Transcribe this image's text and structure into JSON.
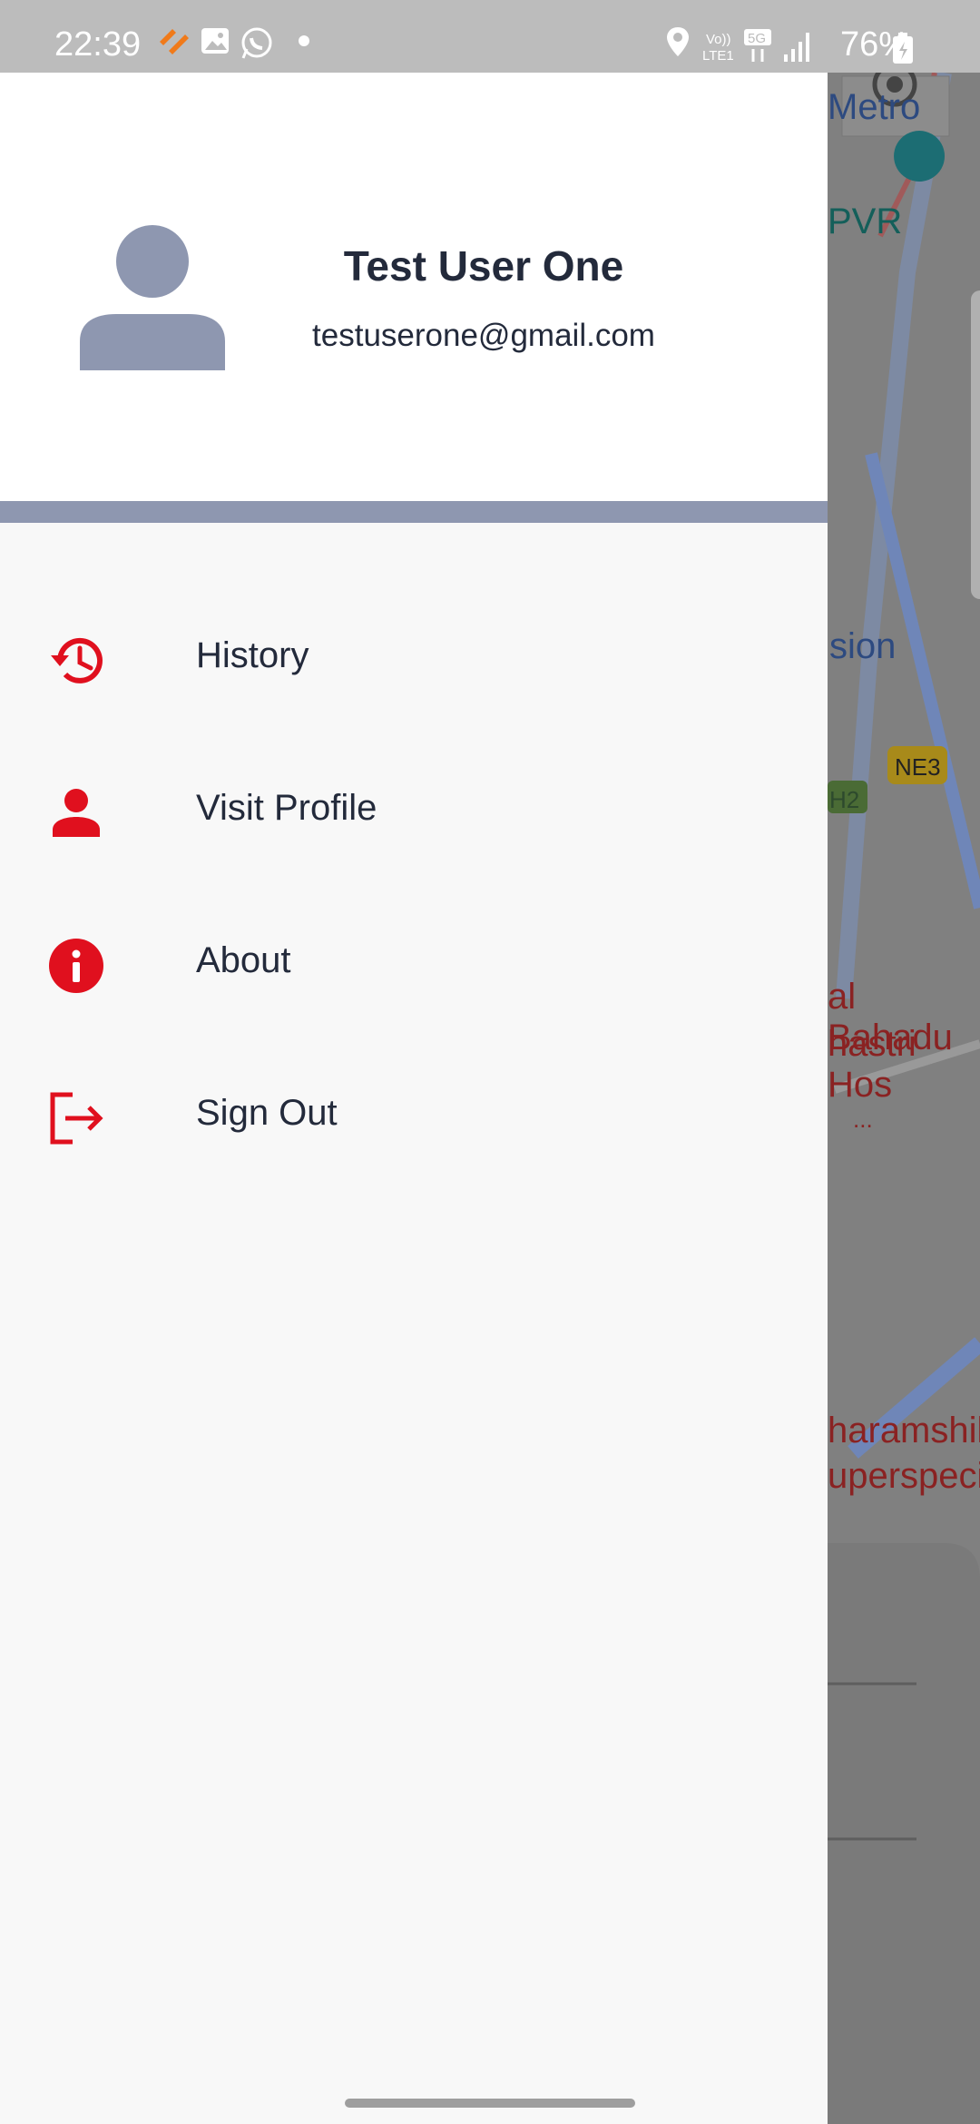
{
  "status_bar": {
    "time": "22:39",
    "battery": "76%",
    "icons": [
      "healthify-icon",
      "gallery-icon",
      "whatsapp-icon",
      "dot-icon",
      "location-icon",
      "volte-icon",
      "5g-icon",
      "signal-icon",
      "battery-icon"
    ]
  },
  "drawer": {
    "user": {
      "name": "Test User One",
      "email": "testuserone@gmail.com"
    },
    "menu": [
      {
        "label": "History",
        "icon": "history-icon"
      },
      {
        "label": "Visit Profile",
        "icon": "person-icon"
      },
      {
        "label": "About",
        "icon": "info-icon"
      },
      {
        "label": "Sign Out",
        "icon": "sign-out-icon"
      }
    ]
  },
  "map": {
    "labels": [
      "Metro",
      "PVR",
      "sion",
      "NE3",
      "H2",
      "al Bahadu",
      "hastri Hos",
      "...",
      "haramshil",
      "uperspeci"
    ]
  },
  "colors": {
    "accent": "#e0101e",
    "text": "#232a3b",
    "header_divider": "#8e97b0",
    "avatar": "#8e97b0"
  }
}
